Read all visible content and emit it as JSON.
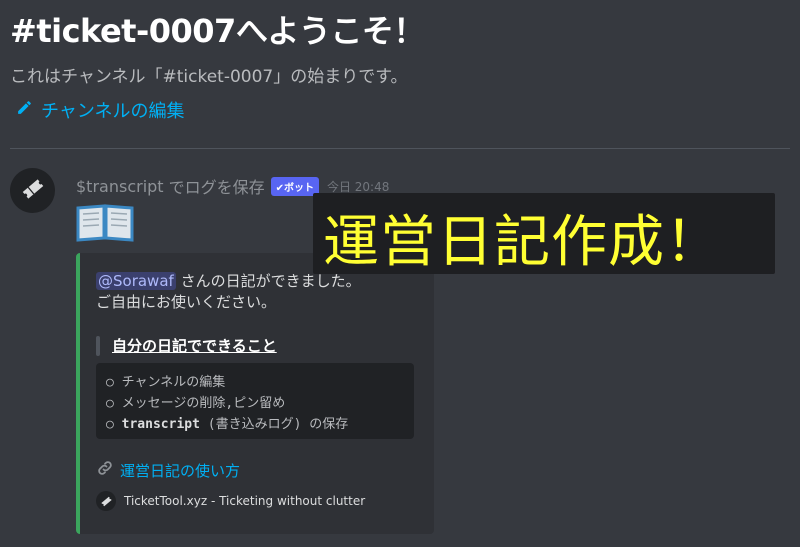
{
  "channel": {
    "welcome_title": "#ticket-0007へようこそ！",
    "welcome_subtitle": "これはチャンネル「#ticket-0007」の始まりです。",
    "edit_link_label": "チャンネルの編集",
    "edit_icon": "pencil-icon"
  },
  "message": {
    "author": "$transcript",
    "author_suffix": "でログを保存",
    "bot_badge": "✔ボット",
    "timestamp": "今日 20:48",
    "avatar_icon": "ticket-icon",
    "emoji": "open-book-emoji",
    "embed": {
      "accent_color": "#3ba55d",
      "mention": "@Sorawaf",
      "description_line1": "さんの日記ができました。",
      "description_line2": "ご自由にお使いください。",
      "section_heading": "自分の日記でできること",
      "code_lines": [
        {
          "marker": "○",
          "text": "チャンネルの編集"
        },
        {
          "marker": "○",
          "text": "メッセージの削除,ピン留め"
        },
        {
          "marker": "○",
          "keyword": "transcript",
          "text": "(書き込みログ) の保存"
        }
      ],
      "link_label": "運営日記の使い方",
      "link_icon": "link-icon",
      "footer_text": "TicketTool.xyz - Ticketing without clutter",
      "footer_icon": "ticket-icon"
    }
  },
  "overlay_caption": "運営日記作成！",
  "colors": {
    "background": "#36393f",
    "link": "#00b0f4",
    "caption": "#ffff33"
  }
}
